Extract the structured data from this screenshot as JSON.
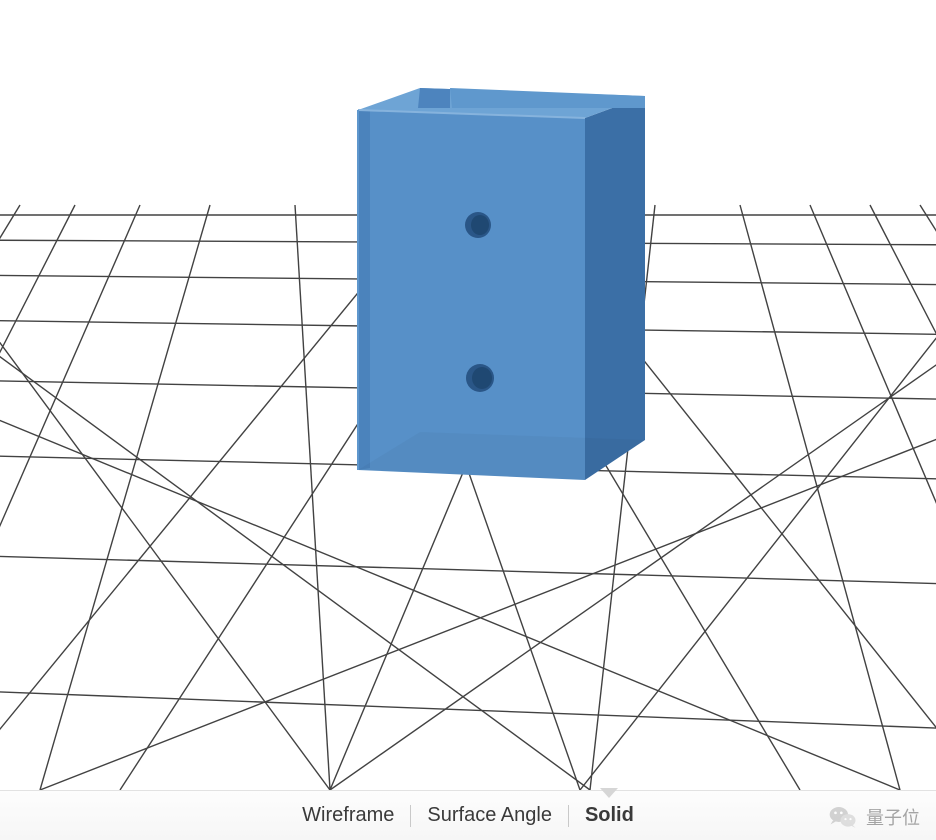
{
  "view_modes": {
    "wireframe": "Wireframe",
    "surface_angle": "Surface Angle",
    "solid": "Solid",
    "active": "solid"
  },
  "watermark": {
    "icon_name": "wechat-icon",
    "text": "量子位"
  },
  "model": {
    "description": "Blue rectangular bracket with two circular through-holes",
    "color_front": "#5790c8",
    "color_top": "#6ea2d3",
    "color_side": "#3d6ea5",
    "hole_color": "#2e5a8a",
    "grid_color": "#424242"
  }
}
